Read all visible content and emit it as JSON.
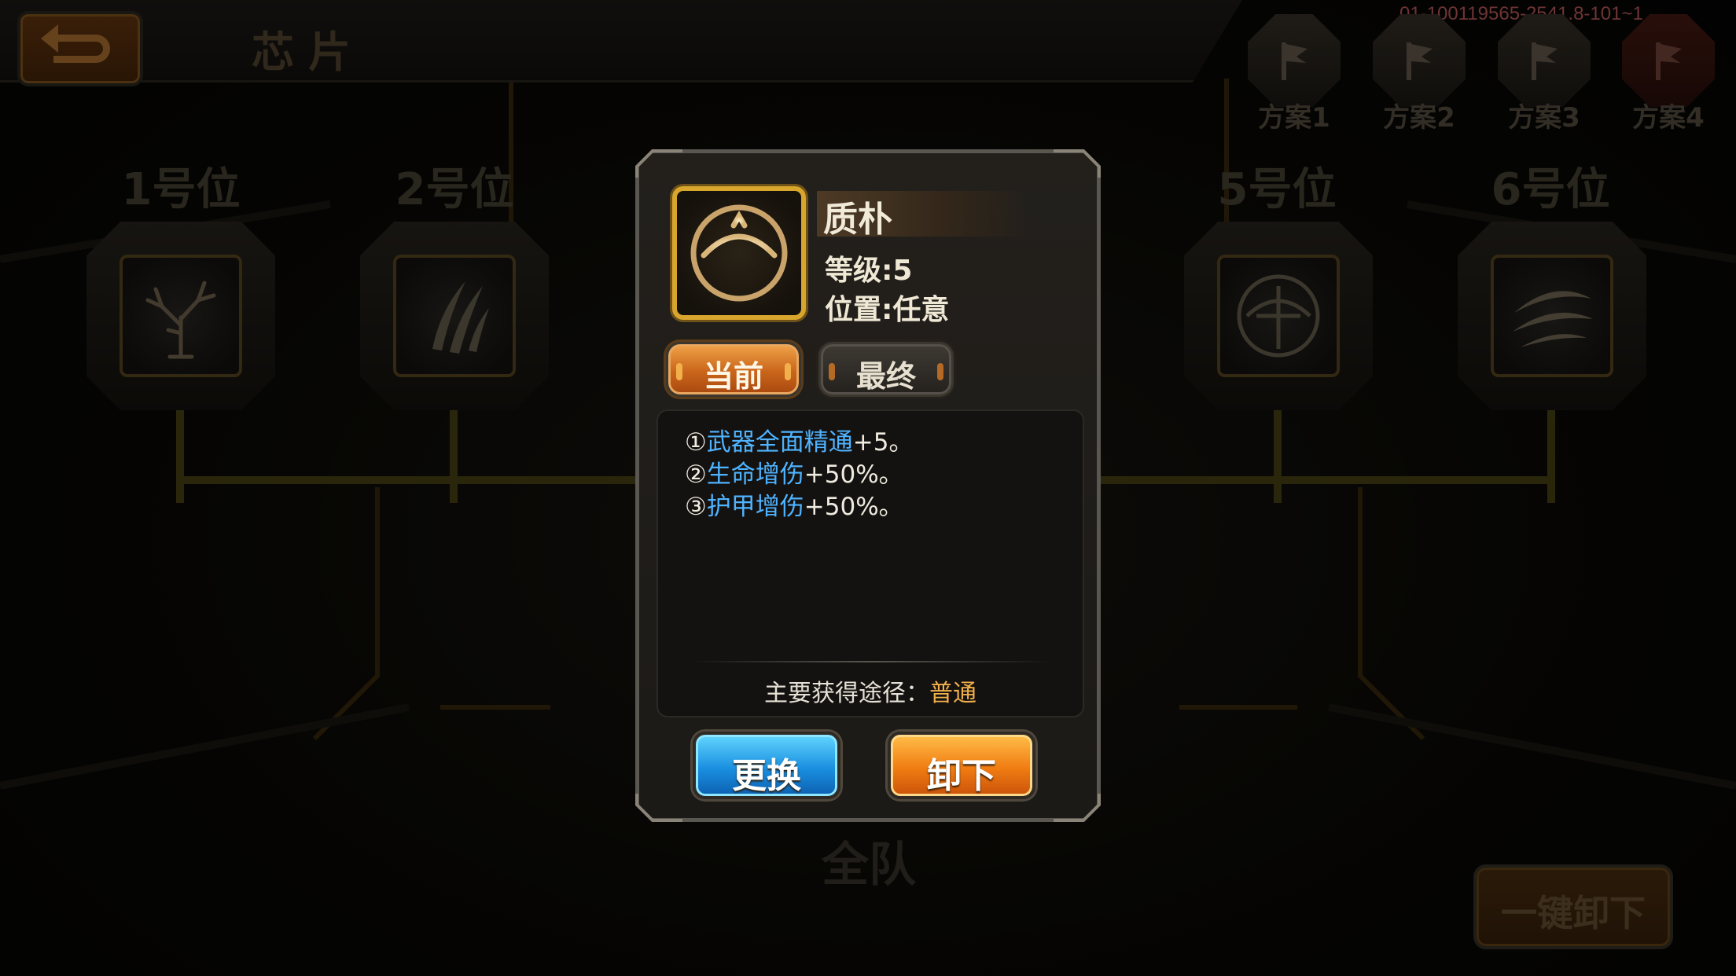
{
  "header": {
    "title": "芯片",
    "version": "01-100119565-2541.8-101~1",
    "back_icon": "back-arrow-icon"
  },
  "plans": [
    {
      "label": "方案1",
      "icon": "flag-icon",
      "active": false
    },
    {
      "label": "方案2",
      "icon": "flag-icon",
      "active": false
    },
    {
      "label": "方案3",
      "icon": "flag-icon",
      "active": false
    },
    {
      "label": "方案4",
      "icon": "flag-icon",
      "active": true
    }
  ],
  "slots": [
    {
      "label": "1号位",
      "icon": "withered-tree-icon"
    },
    {
      "label": "2号位",
      "icon": "claw-slash-icon"
    },
    {
      "label": "5号位",
      "icon": "crossbow-icon"
    },
    {
      "label": "6号位",
      "icon": "blade-swirl-icon"
    }
  ],
  "team_label": "全队",
  "unequip_all_label": "一键卸下",
  "popup": {
    "chip": {
      "name": "质朴",
      "icon": "crossbow-icon",
      "level_text": "等级:5",
      "position_text": "位置:任意"
    },
    "tabs": {
      "current": "当前",
      "final": "最终",
      "selected": "current"
    },
    "effects": [
      {
        "index": "①",
        "name": "武器全面精通",
        "value": "+5。"
      },
      {
        "index": "②",
        "name": "生命增伤",
        "value": "+50%。"
      },
      {
        "index": "③",
        "name": "护甲增伤",
        "value": "+50%。"
      }
    ],
    "source": {
      "label": "主要获得途径：",
      "value": "普通"
    },
    "buttons": {
      "replace": "更换",
      "unequip": "卸下"
    }
  },
  "colors": {
    "accent_gold": "#d8a52d",
    "effect_blue": "#4fb3ff",
    "source_orange": "#f2b04b",
    "version_red": "#c76060"
  }
}
